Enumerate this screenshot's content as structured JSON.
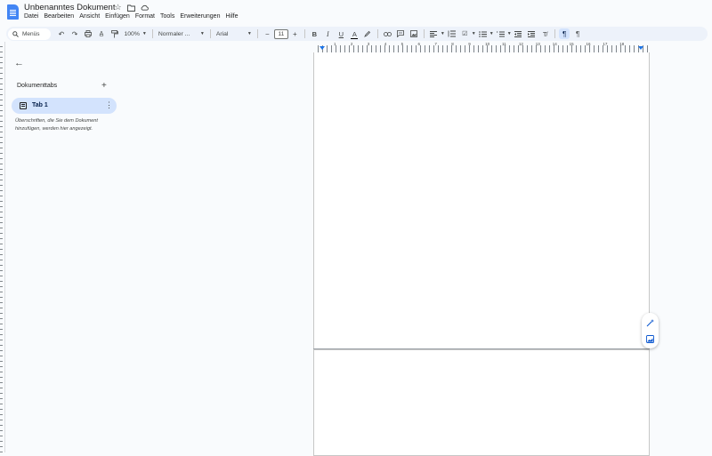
{
  "header": {
    "title": "Unbenanntes Dokument",
    "icons": [
      "star-icon",
      "folder-move-icon",
      "cloud-status-icon"
    ]
  },
  "menubar": [
    "Datei",
    "Bearbeiten",
    "Ansicht",
    "Einfügen",
    "Format",
    "Tools",
    "Erweiterungen",
    "Hilfe"
  ],
  "toolbar": {
    "search_label": "Menüs",
    "zoom": "100%",
    "style": "Normaler ...",
    "font": "Arial",
    "font_size": "11"
  },
  "sidebar": {
    "section_title": "Dokumenttabs",
    "tabs": [
      {
        "label": "Tab 1"
      }
    ],
    "hint": "Überschriften, die Sie dem Dokument hinzufügen, werden hier angezeigt."
  },
  "ruler": {
    "numbers": [
      "1",
      "2",
      "3",
      "4",
      "5",
      "6",
      "7",
      "8",
      "9",
      "10",
      "11",
      "12",
      "13",
      "14",
      "15",
      "16",
      "17",
      "18"
    ]
  },
  "colors": {
    "accent": "#0b57d0",
    "active_bg": "#d3e3fd",
    "toolbar_bg": "#edf2fa",
    "page_bg": "#f9fbfd"
  }
}
